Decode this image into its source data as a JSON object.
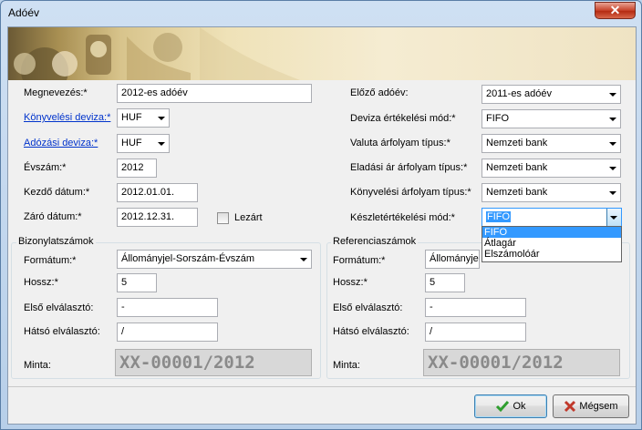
{
  "window": {
    "title": "Adóév",
    "close_glyph": "✕"
  },
  "left": {
    "name_label": "Megnevezés:*",
    "name_value": "2012-es adóév",
    "acc_currency_label": "Könyvelési deviza:*",
    "acc_currency_value": "HUF",
    "tax_currency_label": "Adózási deviza:*",
    "tax_currency_value": "HUF",
    "year_label": "Évszám:*",
    "year_value": "2012",
    "start_label": "Kezdő dátum:*",
    "start_value": "2012.01.01.",
    "end_label": "Záró dátum:*",
    "end_value": "2012.12.31.",
    "closed_label": "Lezárt",
    "closed_checked": false
  },
  "right": {
    "prev_year_label": "Előző adóév:",
    "prev_year_value": "2011-es adóév",
    "fx_valuation_label": "Deviza értékelési mód:*",
    "fx_valuation_value": "FIFO",
    "fx_rate_type_label": "Valuta árfolyam típus:*",
    "fx_rate_type_value": "Nemzeti bank",
    "sales_rate_type_label": "Eladási ár árfolyam típus:*",
    "sales_rate_type_value": "Nemzeti bank",
    "acc_rate_type_label": "Könyvelési árfolyam típus:*",
    "acc_rate_type_value": "Nemzeti bank",
    "stock_valuation_label": "Készletértékelési mód:*",
    "stock_valuation_value": "FIFO",
    "stock_valuation_options": [
      "FIFO",
      "Átlagár",
      "Elszámolóár"
    ]
  },
  "voucher_numbers": {
    "title": "Bizonylatszámok",
    "format_label": "Formátum:*",
    "format_value": "Állományjel-Sorszám-Évszám",
    "length_label": "Hossz:*",
    "length_value": "5",
    "first_sep_label": "Első elválasztó:",
    "first_sep_value": "-",
    "rear_sep_label": "Hátsó elválasztó:",
    "rear_sep_value": "/",
    "sample_label": "Minta:",
    "sample_value": "XX-00001/2012"
  },
  "reference_numbers": {
    "title": "Referenciaszámok",
    "format_label": "Formátum:*",
    "format_value": "Állományjel-Sorszám-Évszám",
    "length_label": "Hossz:*",
    "length_value": "5",
    "first_sep_label": "Első elválasztó:",
    "first_sep_value": "-",
    "rear_sep_label": "Hátsó elválasztó:",
    "rear_sep_value": "/",
    "sample_label": "Minta:",
    "sample_value": "XX-00001/2012"
  },
  "buttons": {
    "ok_label": "Ok",
    "cancel_label": "Mégsem"
  },
  "colors": {
    "link": "#0033cc",
    "selection": "#3399ff",
    "ok_check": "#2e9e2e",
    "cancel_x": "#c0392b"
  }
}
